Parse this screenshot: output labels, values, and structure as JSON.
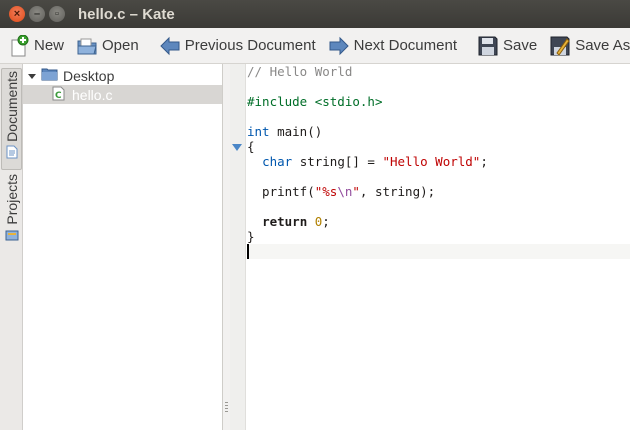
{
  "window": {
    "title": "hello.c – Kate",
    "close_glyph": "×",
    "min_glyph": "–",
    "max_glyph": "▫"
  },
  "toolbar": {
    "new_label": "New",
    "open_label": "Open",
    "prev_doc_label": "Previous Document",
    "next_doc_label": "Next Document",
    "save_label": "Save",
    "save_as_label": "Save As"
  },
  "side_tabs": {
    "documents_label": "Documents",
    "projects_label": "Projects"
  },
  "tree": {
    "folder": "Desktop",
    "file": "hello.c"
  },
  "code": {
    "line1_comment": "// Hello World",
    "line3_directive": "#include ",
    "line3_header": "<stdio.h>",
    "line5_type": "int",
    "line5_rest": " main()",
    "line6": "{",
    "line7_indent": "  ",
    "line7_type": "char",
    "line7_rest": " string[] = ",
    "line7_string": "\"Hello World\"",
    "line7_end": ";",
    "line9_call": "  printf(",
    "line9_str_a": "\"%s",
    "line9_escape": "\\n",
    "line9_str_b": "\"",
    "line9_rest": ", string);",
    "line11_indent": "  ",
    "line11_keyword": "return",
    "line11_space": " ",
    "line11_number": "0",
    "line11_end": ";",
    "line12": "}"
  },
  "icons": {
    "new": "document-new-icon",
    "open": "folder-open-icon",
    "prev": "arrow-left-icon",
    "next": "arrow-right-icon",
    "save": "floppy-disk-icon",
    "save_as": "save-as-icon"
  },
  "colors": {
    "accent": "#4a86c7",
    "close_button": "#df4a16",
    "comment": "#898887",
    "preprocessor": "#006e28",
    "type": "#0057ae",
    "string": "#bf0303",
    "number": "#b08000"
  }
}
